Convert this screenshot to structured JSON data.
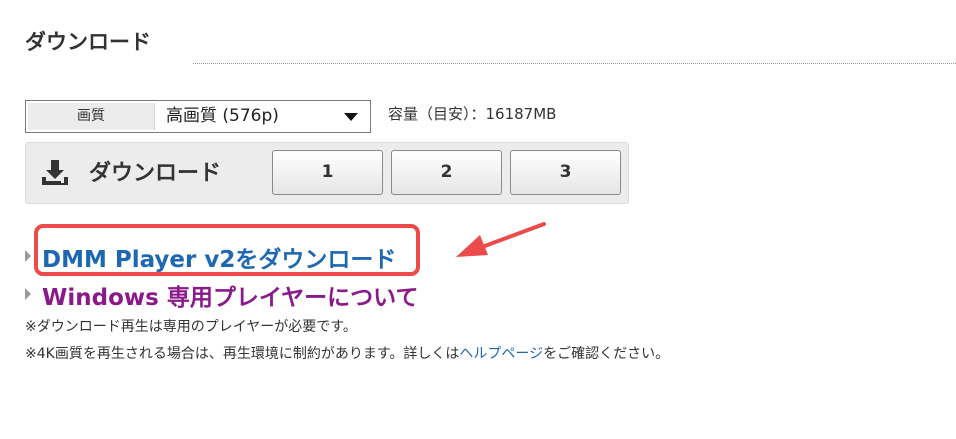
{
  "section": {
    "title": "ダウンロード"
  },
  "quality": {
    "label": "画質",
    "selected": "高画質 (576p)",
    "capacity": "容量（目安）：16187MB"
  },
  "download_panel": {
    "label": "ダウンロード",
    "parts": [
      "1",
      "2",
      "3"
    ]
  },
  "links": {
    "player_download": "DMM Player v2をダウンロード",
    "windows_player": "Windows 専用プレイヤーについて"
  },
  "notes": {
    "line1": "※ダウンロード再生は専用のプレイヤーが必要です。",
    "line2_before": "※4K画質を再生される場合は、再生環境に制約があります。詳しくは",
    "line2_link": "ヘルプページ",
    "line2_after": "をご確認ください。"
  },
  "colors": {
    "link_blue": "#1e67b2",
    "link_purple": "#8a1a8a",
    "annotation_red": "#ec4b4b"
  },
  "icons": {
    "download": "download-icon",
    "dropdown": "caret-down-icon",
    "bullet": "triangle-right-icon",
    "annotation": "arrow-icon"
  }
}
